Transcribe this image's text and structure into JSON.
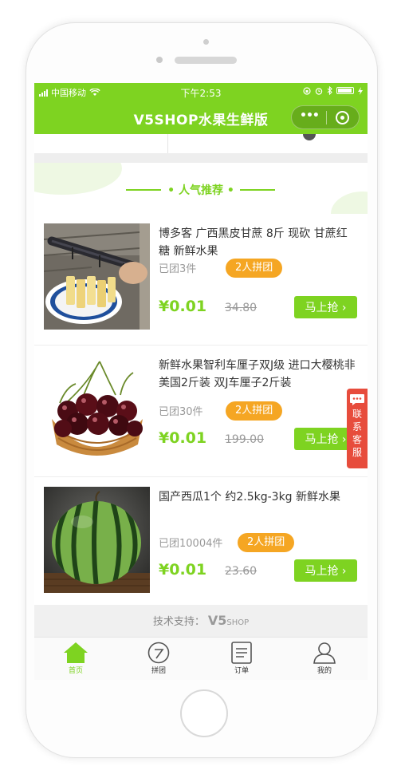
{
  "status_bar": {
    "carrier": "中国移动",
    "time": "下午2:53"
  },
  "navbar": {
    "title": "V5SHOP水果生鲜版"
  },
  "section": {
    "title": "• 人气推荐 •"
  },
  "products": [
    {
      "name": "博多客 广西黑皮甘蔗 8斤 现砍 甘蔗红糖 新鲜水果",
      "sold": "已团3件",
      "badge": "2人拼团",
      "price": "¥0.01",
      "old_price": "34.80",
      "buy_label": "马上抢 ›",
      "image": "sugarcane-photo"
    },
    {
      "name": "新鲜水果智利车厘子双J级 进口大樱桃非美国2斤装 双J车厘子2斤装",
      "sold": "已团30件",
      "badge": "2人拼团",
      "price": "¥0.01",
      "old_price": "199.00",
      "buy_label": "马上抢 ›",
      "image": "cherries-photo"
    },
    {
      "name": "国产西瓜1个 约2.5kg-3kg 新鲜水果",
      "sold": "已团10004件",
      "badge": "2人拼团",
      "price": "¥0.01",
      "old_price": "23.60",
      "buy_label": "马上抢 ›",
      "image": "watermelon-photo"
    }
  ],
  "support": {
    "label": "技术支持：",
    "brand": "V5",
    "brand_suffix": "SHOP"
  },
  "tabbar": [
    {
      "label": "首页",
      "icon": "home-icon",
      "active": true
    },
    {
      "label": "拼团",
      "icon": "group-icon",
      "active": false
    },
    {
      "label": "订单",
      "icon": "order-icon",
      "active": false
    },
    {
      "label": "我的",
      "icon": "user-icon",
      "active": false
    }
  ],
  "floating": {
    "label": "联系客服",
    "icon": "chat-icon"
  },
  "colors": {
    "primary": "#7ed321",
    "badge": "#f5a623",
    "contact": "#e74c3c"
  }
}
